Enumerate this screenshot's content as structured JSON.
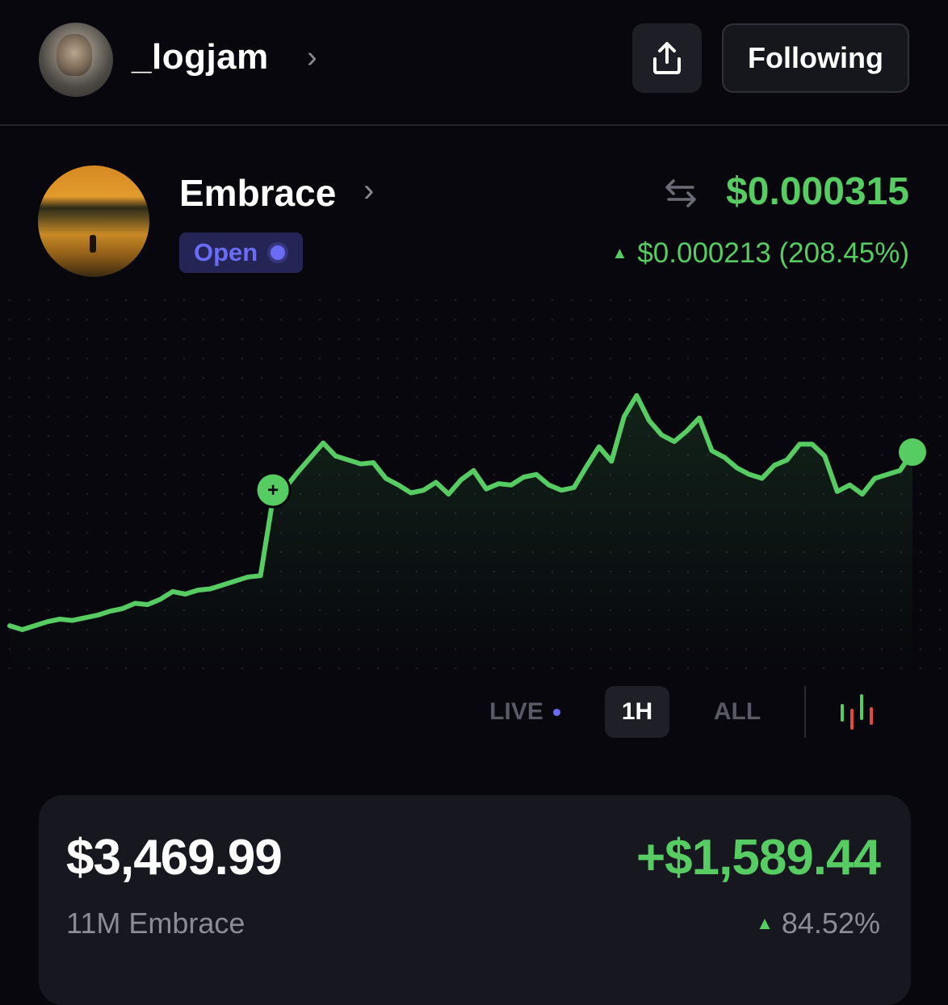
{
  "header": {
    "username": "_logjam",
    "chevron": "›",
    "share_icon": "share-upload-icon",
    "follow_label": "Following"
  },
  "token": {
    "name": "Embrace",
    "chevron": "›",
    "status": "Open",
    "swap_icon": "swap-arrows-icon",
    "price": "$0.000315",
    "change": "$0.000213 (208.45%)",
    "change_direction": "up"
  },
  "chart_controls": {
    "live_label": "LIVE",
    "ranges": [
      "1H",
      "ALL"
    ],
    "selected_range": "1H",
    "candles_icon": "candlestick-icon"
  },
  "chart_data": {
    "type": "line",
    "series": [
      {
        "values": [
          8.6,
          8.3,
          8.6,
          8.9,
          9.1,
          9.0,
          9.2,
          9.4,
          9.7,
          9.9,
          10.3,
          10.2,
          10.6,
          11.2,
          11.0,
          11.3,
          11.4,
          11.7,
          12.0,
          12.3,
          12.4,
          18.3,
          19.1,
          20.3,
          21.4,
          22.5,
          21.5,
          21.2,
          20.9,
          21.0,
          19.8,
          19.3,
          18.7,
          18.9,
          19.5,
          18.6,
          19.7,
          20.4,
          19.0,
          19.4,
          19.3,
          19.9,
          20.1,
          19.3,
          18.9,
          19.1,
          20.7,
          22.2,
          21.1,
          24.5,
          26.1,
          24.2,
          23.1,
          22.6,
          23.4,
          24.4,
          21.9,
          21.4,
          20.6,
          20.1,
          19.8,
          20.8,
          21.2,
          22.4,
          22.4,
          21.5,
          18.8,
          19.3,
          18.6,
          19.8,
          20.1,
          20.4,
          21.8
        ],
        "color": "#56cc62"
      }
    ],
    "entry_marker_index": 21,
    "entry_marker_label": "+",
    "grid": "dotted",
    "axes_visible": false
  },
  "position": {
    "value": "$3,469.99",
    "gain": "+$1,589.44",
    "holding": "11M Embrace",
    "gain_pct": "84.52%",
    "gain_direction": "up"
  },
  "colors": {
    "background": "#07070d",
    "accent_green": "#56cc62",
    "accent_blue": "#6a6cf5",
    "candle_red": "#e5483f"
  }
}
